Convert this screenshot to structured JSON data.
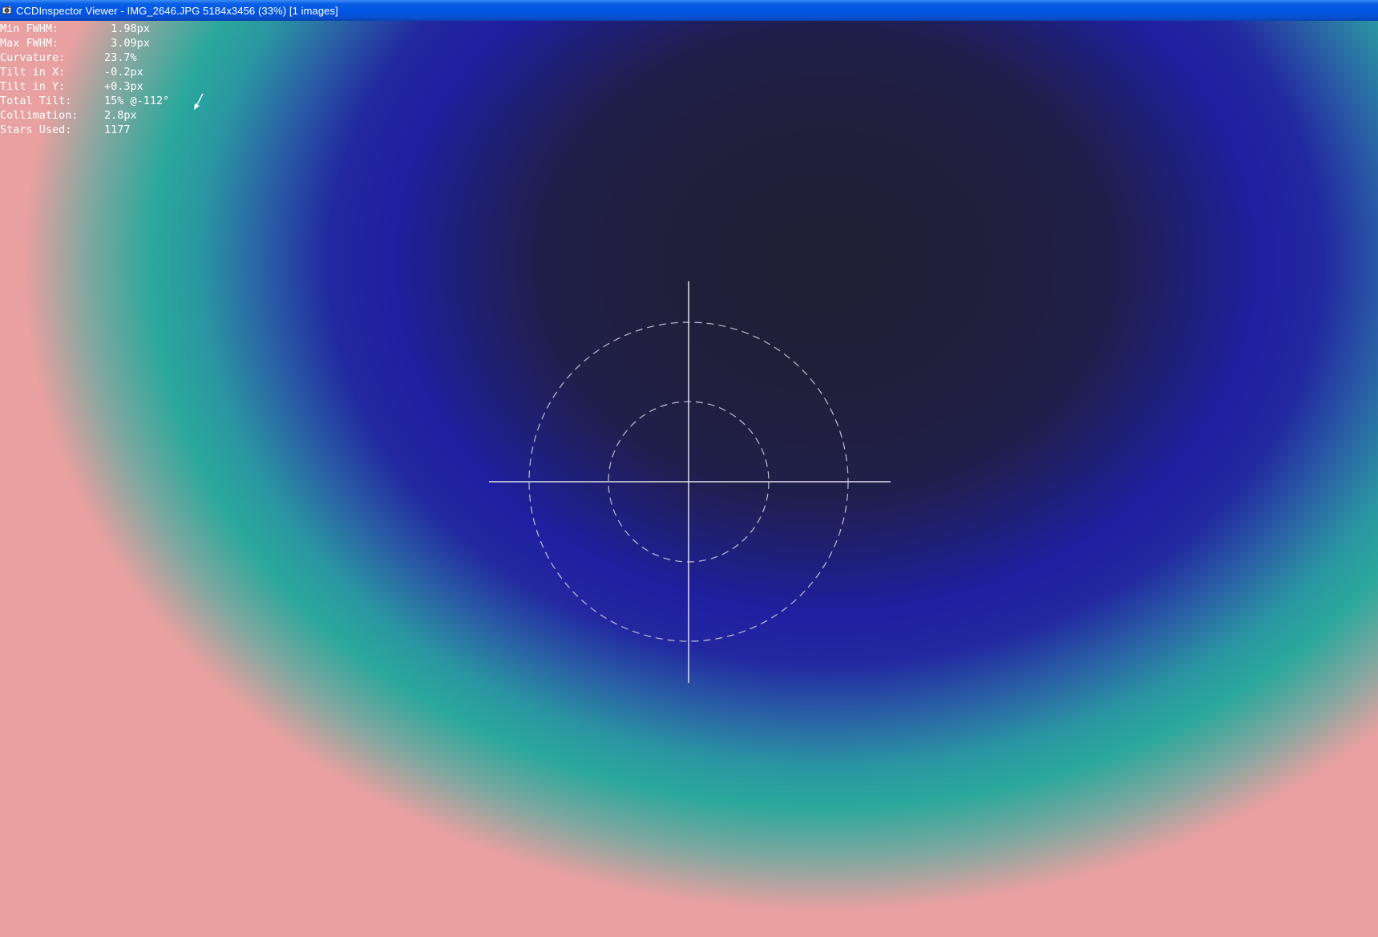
{
  "window": {
    "title": "CCDInspector Viewer - IMG_2646.JPG 5184x3456 (33%)  [1 images]",
    "icon": "app-icon"
  },
  "stats": [
    {
      "label": "Min FWHM:",
      "value": " 1.98px"
    },
    {
      "label": "Max FWHM:",
      "value": " 3.09px"
    },
    {
      "label": "Curvature:",
      "value": "23.7%"
    },
    {
      "label": "Tilt in X:",
      "value": "-0.2px"
    },
    {
      "label": "Tilt in Y:",
      "value": "+0.3px"
    },
    {
      "label": "Total Tilt:",
      "value": "15% @-112°"
    },
    {
      "label": "Collimation:",
      "value": "2.8px"
    },
    {
      "label": "Stars Used:",
      "value": "1177"
    }
  ],
  "tilt_direction_deg": -112,
  "colors": {
    "titlebar": "#0055e3",
    "text": "#ffffff",
    "center": "#211f34",
    "mid": "#1f1fa0",
    "teal": "#2aa89c",
    "corner": "#e8a0a0"
  }
}
